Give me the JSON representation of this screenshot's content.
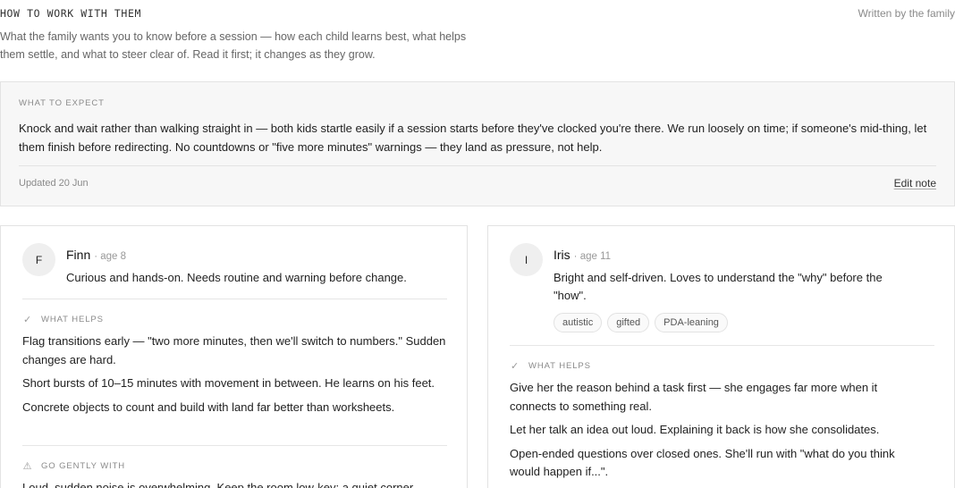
{
  "header": {
    "eyebrow": "HOW TO WORK WITH THEM",
    "byline": "Written by the family",
    "intro": "What the family wants you to know before a session — how each child learns best, what helps them settle, and what to steer clear of. Read it first; it changes as they grow."
  },
  "expect": {
    "label": "What to expect",
    "body": "Knock and wait rather than walking straight in — both kids startle easily if a session starts before they've clocked you're there. We run loosely on time; if someone's mid-thing, let them finish before redirecting. No countdowns or \"five more minutes\" warnings — they land as pressure, not help.",
    "updated": "Updated 20 Jun",
    "edit_label": "Edit note"
  },
  "children": [
    {
      "initial": "F",
      "name": "Finn",
      "age": "age 8",
      "summary": "Curious and hands-on. Needs routine and warning before change.",
      "helps_label": "What helps",
      "helps": [
        "Flag transitions early — \"two more minutes, then we'll switch to numbers.\" Sudden changes are hard.",
        "Short bursts of 10–15 minutes with movement in between. He learns on his feet.",
        "Concrete objects to count and build with land far better than worksheets."
      ],
      "avoid_label": "Go gently with",
      "avoid": [
        "Loud, sudden noise is overwhelming. Keep the room low-key; a quiet corner"
      ]
    },
    {
      "initial": "I",
      "name": "Iris",
      "age": "age 11",
      "summary": "Bright and self-driven. Loves to understand the \"why\" before the \"how\".",
      "tags": [
        "autistic",
        "gifted",
        "PDA-leaning"
      ],
      "helps_label": "What helps",
      "helps": [
        "Give her the reason behind a task first — she engages far more when it connects to something real.",
        "Let her talk an idea out loud. Explaining it back is how she consolidates.",
        "Open-ended questions over closed ones. She'll run with \"what do you think would happen if...\"."
      ]
    }
  ],
  "icons": {
    "helps": "check-icon",
    "avoid": "warning-triangle-icon"
  }
}
